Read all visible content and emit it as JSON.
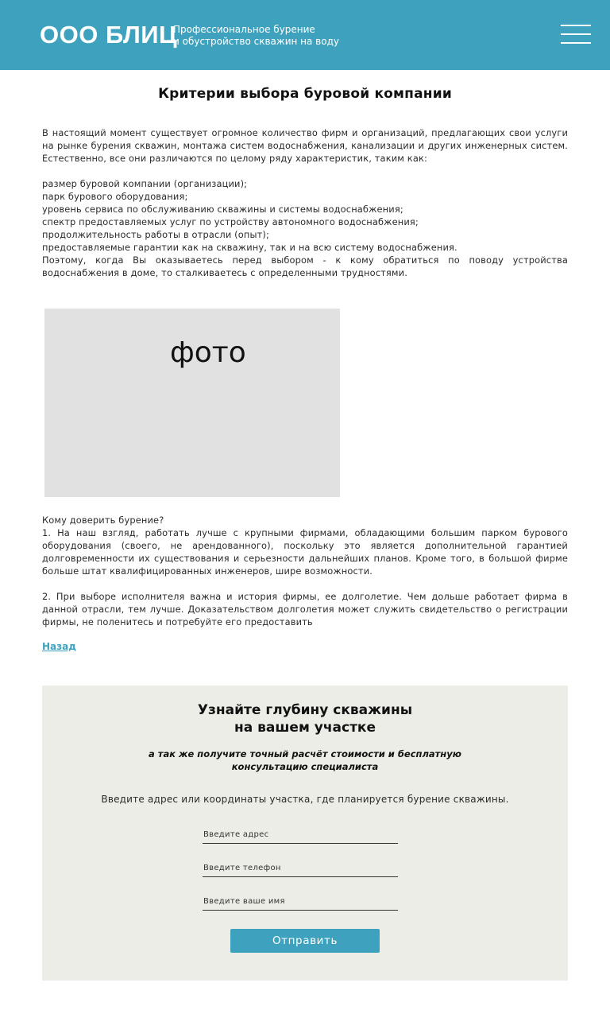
{
  "header": {
    "logo": "ООО БЛИЦ",
    "tagline_line1": "Профессиональное бурение",
    "tagline_line2": "и обустройство скважин на воду",
    "menu_icon": "hamburger-menu-icon",
    "background": "#3ea2bf"
  },
  "article": {
    "title": "Критерии выбора буровой компании",
    "intro": "В настоящий момент существует огромное количество фирм и организаций, предлагающих свои услуги на рынке бурения скважин, монтажа систем водоснабжения, канализации и других инженерных систем. Естественно, все они различаются по целому ряду характеристик, таким как:",
    "criteria": [
      "размер буровой компании (организации);",
      "парк бурового оборудования;",
      "уровень сервиса по обслуживанию скважины и системы водоснабжения;",
      "спектр предоставляемых услуг по устройству автономного водоснабжения;",
      "продолжительность работы в отрасли (опыт);",
      "предоставляемые гарантии как на скважину, так и на всю систему водоснабжения."
    ],
    "conclusion": "Поэтому, когда Вы оказываетесь перед выбором - к кому обратиться по поводу устройства водоснабжения в доме, то сталкиваетесь с определенными трудностями.",
    "photo_label": "фото",
    "question": "Кому доверить бурение?",
    "point1": "1. На наш взгляд, работать лучше с крупными фирмами, обладающими большим парком бурового оборудования (своего, не арендованного), поскольку это является дополнительной гарантией долговременности их существования и серьезности дальнейших планов. Кроме того, в большой фирме больше штат квалифицированных инженеров, шире возможности.",
    "point2": "2. При выборе исполнителя важна и история фирмы, ее долголетие. Чем дольше работает фирма в данной отрасли, тем лучше. Доказательством долголетия может служить свидетельство о регистрации фирмы, не поленитесь и потребуйте его предоставить",
    "back_link": "Назад"
  },
  "form": {
    "title_line1": "Узнайте глубину скважины",
    "title_line2": "на вашем участке",
    "subtitle_line1": "а так же получите точный расчёт стоимости и бесплатную",
    "subtitle_line2": "консультацию специалиста",
    "hint": "Введите адрес или координаты участка, где планируется бурение скважины.",
    "address_placeholder": "Введите адрес",
    "phone_placeholder": "Введите телефон",
    "name_placeholder": "Введите ваше имя",
    "submit_label": "Отправить",
    "panel_color": "#ecede7",
    "accent": "#3ea2bf"
  }
}
